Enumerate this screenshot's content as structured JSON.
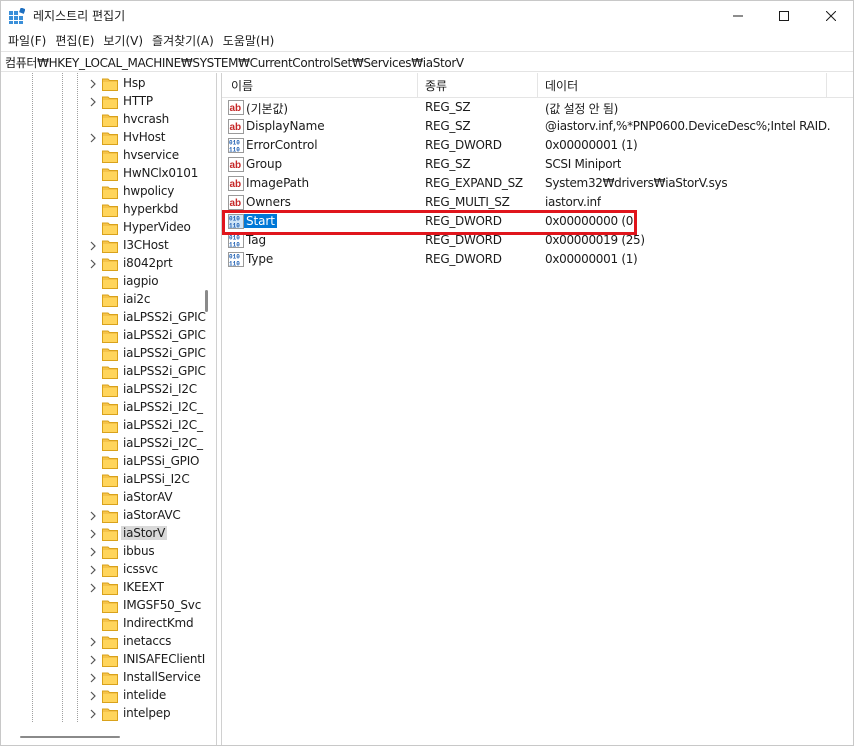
{
  "window": {
    "title": "레지스트리 편집기",
    "controls": {
      "minimize_icon": "minimize-icon",
      "maximize_icon": "maximize-icon",
      "close_icon": "close-icon"
    }
  },
  "menu": [
    "파일(F)",
    "편집(E)",
    "보기(V)",
    "즐겨찾기(A)",
    "도움말(H)"
  ],
  "address": "컴퓨터₩HKEY_LOCAL_MACHINE₩SYSTEM₩CurrentControlSet₩Services₩iaStorV",
  "tree": {
    "items": [
      {
        "label": "Hsp",
        "expandable": true
      },
      {
        "label": "HTTP",
        "expandable": true
      },
      {
        "label": "hvcrash",
        "expandable": false
      },
      {
        "label": "HvHost",
        "expandable": true
      },
      {
        "label": "hvservice",
        "expandable": false
      },
      {
        "label": "HwNClx0101",
        "expandable": false
      },
      {
        "label": "hwpolicy",
        "expandable": false
      },
      {
        "label": "hyperkbd",
        "expandable": false
      },
      {
        "label": "HyperVideo",
        "expandable": false
      },
      {
        "label": "I3CHost",
        "expandable": true
      },
      {
        "label": "i8042prt",
        "expandable": true
      },
      {
        "label": "iagpio",
        "expandable": false
      },
      {
        "label": "iai2c",
        "expandable": false
      },
      {
        "label": "iaLPSS2i_GPIC",
        "expandable": false
      },
      {
        "label": "iaLPSS2i_GPIC",
        "expandable": false
      },
      {
        "label": "iaLPSS2i_GPIC",
        "expandable": false
      },
      {
        "label": "iaLPSS2i_GPIC",
        "expandable": false
      },
      {
        "label": "iaLPSS2i_I2C",
        "expandable": false
      },
      {
        "label": "iaLPSS2i_I2C_",
        "expandable": false
      },
      {
        "label": "iaLPSS2i_I2C_",
        "expandable": false
      },
      {
        "label": "iaLPSS2i_I2C_",
        "expandable": false
      },
      {
        "label": "iaLPSSi_GPIO",
        "expandable": false
      },
      {
        "label": "iaLPSSi_I2C",
        "expandable": false
      },
      {
        "label": "iaStorAV",
        "expandable": false
      },
      {
        "label": "iaStorAVC",
        "expandable": true
      },
      {
        "label": "iaStorV",
        "expandable": true,
        "selected": true
      },
      {
        "label": "ibbus",
        "expandable": true
      },
      {
        "label": "icssvc",
        "expandable": true
      },
      {
        "label": "IKEEXT",
        "expandable": true
      },
      {
        "label": "IMGSF50_Svc",
        "expandable": false
      },
      {
        "label": "IndirectKmd",
        "expandable": false
      },
      {
        "label": "inetaccs",
        "expandable": true
      },
      {
        "label": "INISAFEClientI",
        "expandable": true
      },
      {
        "label": "InstallService",
        "expandable": true
      },
      {
        "label": "intelide",
        "expandable": true
      },
      {
        "label": "intelpep",
        "expandable": true
      }
    ]
  },
  "list": {
    "columns": [
      "이름",
      "종류",
      "데이터"
    ],
    "rows": [
      {
        "name": "(기본값)",
        "type": "REG_SZ",
        "data": "(값 설정 안 됨)",
        "icon": "string-value-icon"
      },
      {
        "name": "DisplayName",
        "type": "REG_SZ",
        "data": "@iastorv.inf,%*PNP0600.DeviceDesc%;Intel RAID...",
        "icon": "string-value-icon"
      },
      {
        "name": "ErrorControl",
        "type": "REG_DWORD",
        "data": "0x00000001 (1)",
        "icon": "binary-value-icon"
      },
      {
        "name": "Group",
        "type": "REG_SZ",
        "data": "SCSI Miniport",
        "icon": "string-value-icon"
      },
      {
        "name": "ImagePath",
        "type": "REG_EXPAND_SZ",
        "data": "System32₩drivers₩iaStorV.sys",
        "icon": "string-value-icon"
      },
      {
        "name": "Owners",
        "type": "REG_MULTI_SZ",
        "data": "iastorv.inf",
        "icon": "string-value-icon"
      },
      {
        "name": "Start",
        "type": "REG_DWORD",
        "data": "0x00000000 (0)",
        "icon": "binary-value-icon",
        "selected": true
      },
      {
        "name": "Tag",
        "type": "REG_DWORD",
        "data": "0x00000019 (25)",
        "icon": "binary-value-icon"
      },
      {
        "name": "Type",
        "type": "REG_DWORD",
        "data": "0x00000001 (1)",
        "icon": "binary-value-icon"
      }
    ]
  },
  "colors": {
    "selection": "#0078d7",
    "highlight_box": "#e0151c",
    "folder": "#f5c34a",
    "tree_selected": "#d9d9d9"
  }
}
